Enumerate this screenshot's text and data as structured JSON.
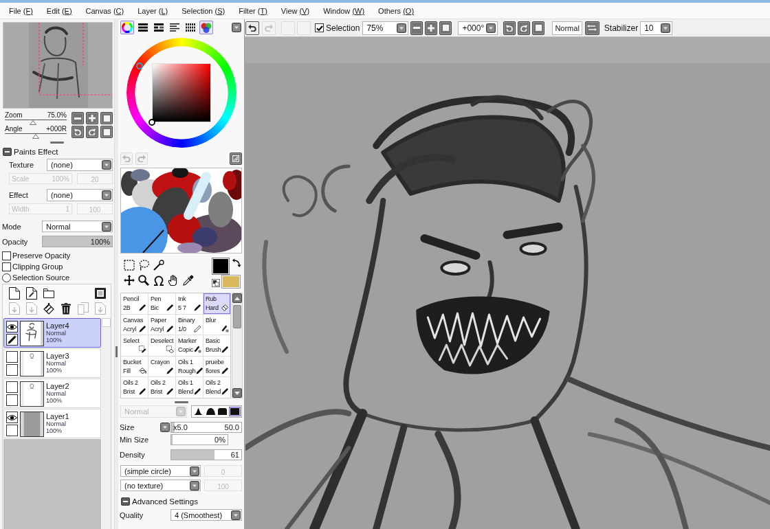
{
  "menu_bar": [
    {
      "label": "File",
      "accelerator": "(F)"
    },
    {
      "label": "Edit",
      "accelerator": "(E)"
    },
    {
      "label": "Canvas",
      "accelerator": "(C)"
    },
    {
      "label": "Layer",
      "accelerator": "(L)"
    },
    {
      "label": "Selection",
      "accelerator": "(S)"
    },
    {
      "label": "Filter",
      "accelerator": "(T)"
    },
    {
      "label": "View",
      "accelerator": "(V)"
    },
    {
      "label": "Window",
      "accelerator": "(W)"
    },
    {
      "label": "Others",
      "accelerator": "(O)"
    }
  ],
  "navigator": {
    "zoom": {
      "label": "Zoom",
      "value": "75.0%",
      "level": 0.46
    },
    "angle": {
      "label": "Angle",
      "value": "+000R",
      "level": 0.5
    }
  },
  "paints_effect": {
    "title": "Paints Effect",
    "expanded": true,
    "texture": {
      "label": "Texture",
      "value": "(none)"
    },
    "texture_params": [
      {
        "label": "Scale",
        "value": "100%",
        "disabled": true
      },
      {
        "value": "20",
        "disabled": true
      }
    ],
    "effect": {
      "label": "Effect",
      "value": "(none)"
    },
    "effect_params": [
      {
        "label": "Width",
        "value": "1",
        "disabled": true
      },
      {
        "value": "100",
        "disabled": true
      }
    ]
  },
  "layer_properties": {
    "mode": {
      "label": "Mode",
      "value": "Normal"
    },
    "opacity": {
      "label": "Opacity",
      "value": "100%",
      "level": 1
    },
    "options": [
      {
        "kind": "checkbox",
        "label": "Preserve Opacity",
        "checked": false
      },
      {
        "kind": "checkbox",
        "label": "Clipping Group",
        "checked": false
      },
      {
        "kind": "radio",
        "label": "Selection Source",
        "checked": false
      }
    ]
  },
  "layer_toolbar": [
    [
      {
        "disabled": false
      },
      {
        "disabled": false
      },
      {
        "disabled": false
      },
      {
        "disabled": false
      }
    ],
    [
      {
        "disabled": true
      },
      {
        "disabled": true
      },
      {
        "disabled": false
      },
      {
        "disabled": false
      },
      {
        "disabled": true
      },
      {
        "disabled": true
      }
    ]
  ],
  "layers": [
    {
      "name": "Layer4",
      "mode": "Normal",
      "opacity": "100%",
      "kind": "figure",
      "visible": true,
      "editing": true,
      "selected": true
    },
    {
      "name": "Layer3",
      "mode": "Normal",
      "opacity": "100%",
      "kind": "sketch",
      "visible": false,
      "editing": false,
      "selected": false
    },
    {
      "name": "Layer2",
      "mode": "Normal",
      "opacity": "100%",
      "kind": "sketch",
      "visible": false,
      "editing": false,
      "selected": false
    },
    {
      "name": "Layer1",
      "mode": "Normal",
      "opacity": "100%",
      "kind": "fill",
      "visible": true,
      "editing": false,
      "selected": false
    }
  ],
  "color_panel": {
    "modes": [
      {
        "on": true
      },
      {
        "on": false
      },
      {
        "on": false
      },
      {
        "on": false
      },
      {
        "on": false
      },
      {
        "on": true
      }
    ],
    "history": [
      {
        "disabled": true
      },
      {
        "disabled": true
      }
    ],
    "swatches": [
      {
        "color": "#000000"
      },
      {
        "color": "#d9b95c"
      }
    ]
  },
  "brushes": [
    {
      "name": "Pencil",
      "detail": "2B",
      "kind": "pen",
      "selected": false
    },
    {
      "name": "Pen",
      "detail": "Bic",
      "kind": "pen",
      "selected": false
    },
    {
      "name": "Ink",
      "detail": "5 7",
      "kind": "pen",
      "selected": false
    },
    {
      "name": "Rub",
      "detail": "Hard",
      "kind": "eraser",
      "selected": true
    },
    {
      "name": "Canvas",
      "detail": "Acryl",
      "kind": "pen",
      "selected": false
    },
    {
      "name": "Paper",
      "detail": "Acryl",
      "kind": "pen",
      "selected": false
    },
    {
      "name": "Binary",
      "detail": "1/0",
      "kind": "pencil",
      "selected": false
    },
    {
      "name": "Blur",
      "kind": "water",
      "selected": false
    },
    {
      "name": "Select",
      "kind": "select",
      "selected": false
    },
    {
      "name": "Deselect",
      "kind": "deselect",
      "selected": false
    },
    {
      "name": "Marker",
      "detail": "Copic",
      "kind": "marker",
      "selected": false
    },
    {
      "name": "Basic",
      "detail": "Brush",
      "kind": "pen",
      "selected": false
    },
    {
      "name": "Bucket",
      "detail": "Fill",
      "kind": "bucket",
      "selected": false
    },
    {
      "name": "Crayon",
      "kind": "pen",
      "selected": false
    },
    {
      "name": "Oils 1",
      "detail": "Rough",
      "kind": "pen",
      "selected": false
    },
    {
      "name": "pruebe",
      "detail": "flores",
      "kind": "pen",
      "selected": false
    },
    {
      "name": "Oils 2",
      "detail": "Brist",
      "kind": "pen",
      "selected": false
    },
    {
      "name": "Oils 2",
      "detail": "Brist",
      "kind": "pen",
      "selected": false
    },
    {
      "name": "Oils 1",
      "detail": "Blend",
      "kind": "pen",
      "selected": false
    },
    {
      "name": "Oils 2",
      "detail": "Blend",
      "kind": "pen",
      "selected": false
    }
  ],
  "brush_settings": {
    "mode": {
      "value": "Normal",
      "disabled": true
    },
    "tips": [
      {
        "selected": false
      },
      {
        "selected": false
      },
      {
        "selected": false
      },
      {
        "selected": true
      }
    ],
    "size": {
      "label": "Size",
      "multiplier": "x5.0",
      "value": "50.0",
      "level": 0.03
    },
    "min_size": {
      "label": "Min Size",
      "value": "0%",
      "level": 0
    },
    "density": {
      "label": "Density",
      "value": "61",
      "level": 0.61
    },
    "shape": {
      "value": "(simple circle)"
    },
    "shape_amount": {
      "value": "0",
      "disabled": true
    },
    "texture": {
      "value": "(no texture)"
    },
    "texture_amount": {
      "value": "100",
      "disabled": true
    },
    "advanced": {
      "title": "Advanced Settings",
      "expanded": true
    },
    "quality": {
      "label": "Quality",
      "value": "4 (Smoothest)"
    }
  },
  "toolbar": {
    "history": [
      {
        "disabled": false
      },
      {
        "disabled": true
      }
    ],
    "selection_actions": [
      {
        "disabled": true
      },
      {
        "disabled": true
      }
    ],
    "selection_toggle": {
      "label": "Selection",
      "checked": true
    },
    "zoom": {
      "value": "75%"
    },
    "angle": {
      "value": "+000°"
    },
    "blend_mode": {
      "label": "Normal"
    },
    "stabilizer": {
      "label": "Stabilizer",
      "value": "10"
    }
  }
}
